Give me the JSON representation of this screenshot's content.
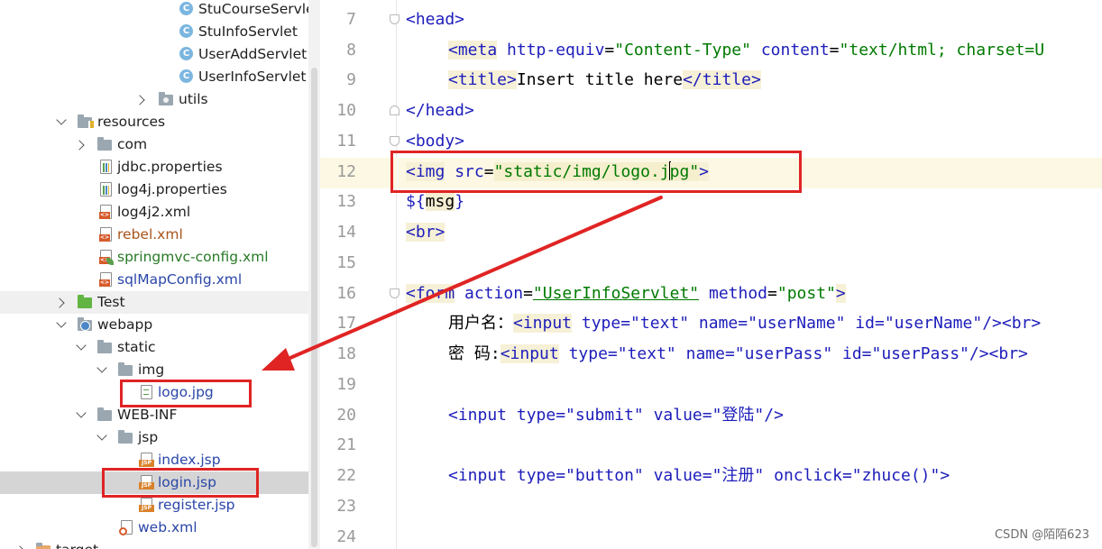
{
  "project_tree": {
    "items": [
      {
        "label": "StuCourseServle",
        "icon": "java-class-icon"
      },
      {
        "label": "StuInfoServlet",
        "icon": "java-class-icon"
      },
      {
        "label": "UserAddServlet",
        "icon": "java-class-icon"
      },
      {
        "label": "UserInfoServlet",
        "icon": "java-class-icon"
      },
      {
        "label": "utils",
        "icon": "package-folder-icon"
      },
      {
        "label": "resources",
        "icon": "resources-folder-icon"
      },
      {
        "label": "com",
        "icon": "folder-icon"
      },
      {
        "label": "jdbc.properties",
        "icon": "properties-file-icon"
      },
      {
        "label": "log4j.properties",
        "icon": "properties-file-icon"
      },
      {
        "label": "log4j2.xml",
        "icon": "xml-file-icon"
      },
      {
        "label": "rebel.xml",
        "icon": "xml-file-icon"
      },
      {
        "label": "springmvc-config.xml",
        "icon": "spring-xml-file-icon"
      },
      {
        "label": "sqlMapConfig.xml",
        "icon": "xml-file-icon"
      },
      {
        "label": "Test",
        "icon": "test-folder-icon"
      },
      {
        "label": "webapp",
        "icon": "web-folder-icon"
      },
      {
        "label": "static",
        "icon": "folder-icon"
      },
      {
        "label": "img",
        "icon": "folder-icon"
      },
      {
        "label": "logo.jpg",
        "icon": "image-file-icon"
      },
      {
        "label": "WEB-INF",
        "icon": "folder-icon"
      },
      {
        "label": "jsp",
        "icon": "folder-icon"
      },
      {
        "label": "index.jsp",
        "icon": "jsp-file-icon"
      },
      {
        "label": "login.jsp",
        "icon": "jsp-file-icon"
      },
      {
        "label": "register.jsp",
        "icon": "jsp-file-icon"
      },
      {
        "label": "web.xml",
        "icon": "web-xml-file-icon"
      },
      {
        "label": "target",
        "icon": "folder-icon"
      }
    ]
  },
  "editor": {
    "line_numbers": [
      "7",
      "8",
      "9",
      "10",
      "11",
      "12",
      "13",
      "14",
      "15",
      "16",
      "17",
      "18",
      "19",
      "20",
      "21",
      "22",
      "23",
      "24"
    ],
    "code": {
      "l7_head_open": "<head>",
      "l8_meta_open": "<meta",
      "l8_attr1": "http-equiv",
      "l8_eq1": "=",
      "l8_val1": "\"Content-Type\"",
      "l8_attr2": "content",
      "l8_eq2": "=",
      "l8_val2": "\"text/html; charset=U",
      "l9_title_open": "<title>",
      "l9_text": "Insert title here",
      "l9_title_close": "</title>",
      "l10_head_close": "</head>",
      "l11_body_open": "<body>",
      "l12_img_open": "<img",
      "l12_attr": "src",
      "l12_eq": "=",
      "l12_val_a": "\"static/img/logo.j",
      "l12_val_b": "pg\"",
      "l12_close": ">",
      "l13_dollar": "${",
      "l13_msg": "msg",
      "l13_brace": "}",
      "l14_br": "<br>",
      "l16_form_open": "<form",
      "l16_attr1": "action",
      "l16_eq1": "=",
      "l16_val1": "\"UserInfoServlet\"",
      "l16_attr2": "method",
      "l16_eq2": "=",
      "l16_val2": "\"post\"",
      "l16_close": ">",
      "l17_label": "用户名：",
      "l17_input": "<input",
      "l17_rest": "type=\"text\" name=\"userName\" id=\"userName\"/><br>",
      "l18_label": "密 码:",
      "l18_input": "<input",
      "l18_rest": "type=\"text\" name=\"userPass\" id=\"userPass\"/><br>",
      "l20_text": "<input type=\"submit\" value=\"登陆\"/>",
      "l22_text": "<input type=\"button\" value=\"注册\" onclick=\"zhuce()\">"
    }
  },
  "watermark": "CSDN @陌陌623",
  "colors": {
    "annotation_red": "#e02424",
    "tag_blue": "#1d1dbb",
    "value_green": "#007a00",
    "current_line": "#fcf8e3"
  }
}
